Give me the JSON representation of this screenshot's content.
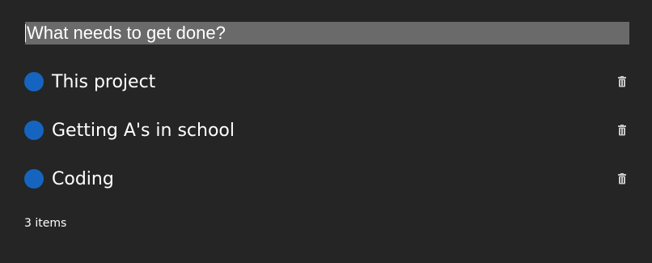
{
  "new_todo": {
    "placeholder": "What needs to get done?",
    "value": ""
  },
  "todos": [
    {
      "label": "This project",
      "completed": false
    },
    {
      "label": "Getting A's in school",
      "completed": false
    },
    {
      "label": "Coding",
      "completed": false
    }
  ],
  "footer": {
    "items_left": "3 items"
  },
  "colors": {
    "background": "#252525",
    "input_background": "#6a6a6a",
    "toggle": "#1565c0",
    "text": "#ffffff",
    "delete_icon": "#c8c8c8"
  },
  "icons": {
    "toggle": "circle-icon",
    "delete": "trash-icon"
  }
}
